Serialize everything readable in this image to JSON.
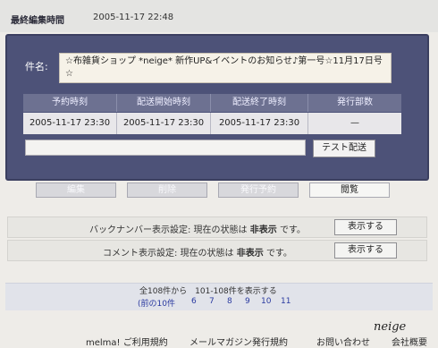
{
  "last_edit": {
    "label": "最終編集時間",
    "value": "2005-11-17 22:48"
  },
  "subject": {
    "label": "件名:",
    "value": "☆布雑貨ショップ *neige* 新作UP&イベントのお知らせ♪第一号☆11月17日号☆"
  },
  "schedule": {
    "headers": [
      "予約時刻",
      "配送開始時刻",
      "配送終了時刻",
      "発行部数"
    ],
    "row": [
      "2005-11-17 23:30",
      "2005-11-17 23:30",
      "2005-11-17 23:30",
      "—"
    ]
  },
  "test_send": {
    "button": "テスト配送",
    "input_value": ""
  },
  "actions": {
    "edit": "編集",
    "delete": "削除",
    "reserve": "発行予約",
    "view": "閲覧"
  },
  "backnumber": {
    "prefix": "バックナンバー表示設定: 現在の状態は",
    "state": "非表示",
    "suffix": "です。",
    "button": "表示する"
  },
  "comment": {
    "prefix": "コメント表示設定: 現在の状態は",
    "state": "非表示",
    "suffix": "です。",
    "button": "表示する"
  },
  "pager": {
    "summary": "全108件から　101-108件を表示する",
    "prev": "(前の10件",
    "pages": [
      "6",
      "7",
      "8",
      "9",
      "10",
      "11"
    ]
  },
  "footer": {
    "links": [
      "melma! ご利用規約",
      "メールマガジン発行規約",
      "お問い合わせ",
      "会社概要"
    ],
    "signature": "neige"
  }
}
